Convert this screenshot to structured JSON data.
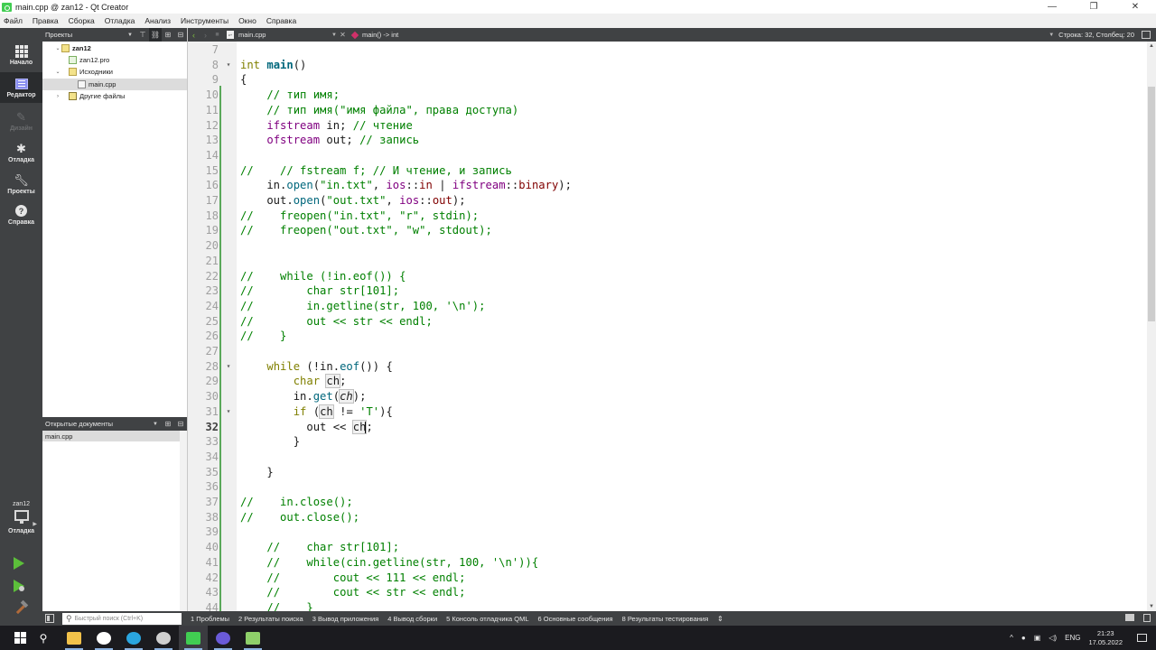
{
  "window": {
    "title": "main.cpp @ zan12 - Qt Creator",
    "controls": {
      "minimize": "—",
      "maximize": "❐",
      "close": "✕"
    }
  },
  "menu": [
    "Файл",
    "Правка",
    "Сборка",
    "Отладка",
    "Анализ",
    "Инструменты",
    "Окно",
    "Справка"
  ],
  "modes": [
    {
      "label": "Начало",
      "icon": "grid-icon",
      "state": "normal"
    },
    {
      "label": "Редактор",
      "icon": "editor-icon",
      "state": "active"
    },
    {
      "label": "Дизайн",
      "icon": "design-pen-icon",
      "state": "disabled"
    },
    {
      "label": "Отладка",
      "icon": "bug-icon",
      "state": "normal"
    },
    {
      "label": "Проекты",
      "icon": "wrench-icon",
      "state": "normal"
    },
    {
      "label": "Справка",
      "icon": "help-icon",
      "state": "normal"
    }
  ],
  "kit": {
    "project": "zan12",
    "mode": "Отладка"
  },
  "projects_panel": {
    "title": "Проекты",
    "tree": [
      {
        "label": "zan12",
        "level": 0,
        "expanded": true,
        "icon": "project-folder-icon",
        "bold": true
      },
      {
        "label": "zan12.pro",
        "level": 1,
        "icon": "pro-file-icon"
      },
      {
        "label": "Исходники",
        "level": 1,
        "expanded": true,
        "icon": "sources-folder-icon"
      },
      {
        "label": "main.cpp",
        "level": 2,
        "icon": "cpp-file-icon",
        "selected": true
      },
      {
        "label": "Другие файлы",
        "level": 1,
        "expanded": false,
        "icon": "other-files-folder-icon"
      }
    ]
  },
  "open_documents": {
    "title": "Открытые документы",
    "items": [
      "main.cpp"
    ]
  },
  "editor_toolbar": {
    "file": "main.cpp",
    "symbol": "main() -> int",
    "position": "Строка: 32, Столбец: 20"
  },
  "editor": {
    "current_line": 32,
    "lines": [
      {
        "n": 7,
        "html": ""
      },
      {
        "n": 8,
        "fold": true,
        "html": "<span class='kw'>int</span> <span class='fn'>main</span>()"
      },
      {
        "n": 9,
        "html": "{"
      },
      {
        "n": 10,
        "html": "    <span class='cm'>// тип имя;</span>"
      },
      {
        "n": 11,
        "html": "    <span class='cm'>// тип имя(\"имя файла\", права доступа)</span>"
      },
      {
        "n": 12,
        "html": "    <span class='en'>ifstream</span> in; <span class='cm'>// чтение</span>"
      },
      {
        "n": 13,
        "html": "    <span class='en'>ofstream</span> out; <span class='cm'>// запись</span>"
      },
      {
        "n": 14,
        "html": ""
      },
      {
        "n": 15,
        "html": "<span class='cm'>//    // fstream f; // И чтение, и запись</span>"
      },
      {
        "n": 16,
        "html": "    in.<span class='fn' style='font-weight:normal'>open</span>(<span class='str'>\"in.txt\"</span>, <span class='en'>ios</span>::<span class='mem'>in</span> | <span class='en'>ifstream</span>::<span class='mem'>binary</span>);"
      },
      {
        "n": 17,
        "html": "    out.<span class='fn' style='font-weight:normal'>open</span>(<span class='str'>\"out.txt\"</span>, <span class='en'>ios</span>::<span class='mem'>out</span>);"
      },
      {
        "n": 18,
        "html": "<span class='cm'>//    freopen(\"in.txt\", \"r\", stdin);</span>"
      },
      {
        "n": 19,
        "html": "<span class='cm'>//    freopen(\"out.txt\", \"w\", stdout);</span>"
      },
      {
        "n": 20,
        "html": ""
      },
      {
        "n": 21,
        "html": ""
      },
      {
        "n": 22,
        "html": "<span class='cm'>//    while (!in.eof()) {</span>"
      },
      {
        "n": 23,
        "html": "<span class='cm'>//        char str[101];</span>"
      },
      {
        "n": 24,
        "html": "<span class='cm'>//        in.getline(str, 100, '\\n');</span>"
      },
      {
        "n": 25,
        "html": "<span class='cm'>//        out &lt;&lt; str &lt;&lt; endl;</span>"
      },
      {
        "n": 26,
        "html": "<span class='cm'>//    }</span>"
      },
      {
        "n": 27,
        "html": ""
      },
      {
        "n": 28,
        "fold": true,
        "html": "    <span class='kw'>while</span> (!in.<span class='fn' style='font-weight:normal'>eof</span>()) {"
      },
      {
        "n": 29,
        "html": "        <span class='kw'>char</span> <span class='sym'>ch</span>;"
      },
      {
        "n": 30,
        "html": "        in.<span class='fn' style='font-weight:normal'>get</span>(<span class='sym it'>ch</span>);"
      },
      {
        "n": 31,
        "fold": true,
        "html": "        <span class='kw'>if</span> (<span class='sym'>ch</span> != <span class='str'>'T'</span>){"
      },
      {
        "n": 32,
        "html": "          out &lt;&lt; <span class='sym'>ch</span><span class='caret'></span>;"
      },
      {
        "n": 33,
        "html": "        }"
      },
      {
        "n": 34,
        "html": ""
      },
      {
        "n": 35,
        "html": "    }"
      },
      {
        "n": 36,
        "html": ""
      },
      {
        "n": 37,
        "html": "<span class='cm'>//    in.close();</span>"
      },
      {
        "n": 38,
        "html": "<span class='cm'>//    out.close();</span>"
      },
      {
        "n": 39,
        "html": ""
      },
      {
        "n": 40,
        "html": "    <span class='cm'>//    char str[101];</span>"
      },
      {
        "n": 41,
        "html": "    <span class='cm'>//    while(cin.getline(str, 100, '\\n')){</span>"
      },
      {
        "n": 42,
        "html": "    <span class='cm'>//        cout &lt;&lt; 111 &lt;&lt; endl;</span>"
      },
      {
        "n": 43,
        "html": "    <span class='cm'>//        cout &lt;&lt; str &lt;&lt; endl;</span>"
      },
      {
        "n": 44,
        "html": "    <span class='cm'>//    }</span>"
      }
    ]
  },
  "locator": {
    "placeholder": "Быстрый поиск (Ctrl+K)"
  },
  "output_panes": [
    "1 Проблемы",
    "2 Результаты поиска",
    "3 Вывод приложения",
    "4 Вывод сборки",
    "5 Консоль отладчика QML",
    "6 Основные сообщения",
    "8 Результаты тестирования"
  ],
  "taskbar": {
    "apps": [
      {
        "name": "file-explorer-icon",
        "color": "#f2c24a"
      },
      {
        "name": "yandex-browser-icon",
        "color": "#ffffff"
      },
      {
        "name": "edge-browser-icon",
        "color": "#2aa6e0"
      },
      {
        "name": "obs-studio-icon",
        "color": "#cfcfcf"
      },
      {
        "name": "qt-creator-icon",
        "color": "#41cd52",
        "active": true
      },
      {
        "name": "video-chat-icon",
        "color": "#6a5ad8"
      },
      {
        "name": "notepad-plus-icon",
        "color": "#8fd06a"
      }
    ],
    "tray": {
      "language": "ENG",
      "time": "21:23",
      "date": "17.05.2022"
    }
  }
}
